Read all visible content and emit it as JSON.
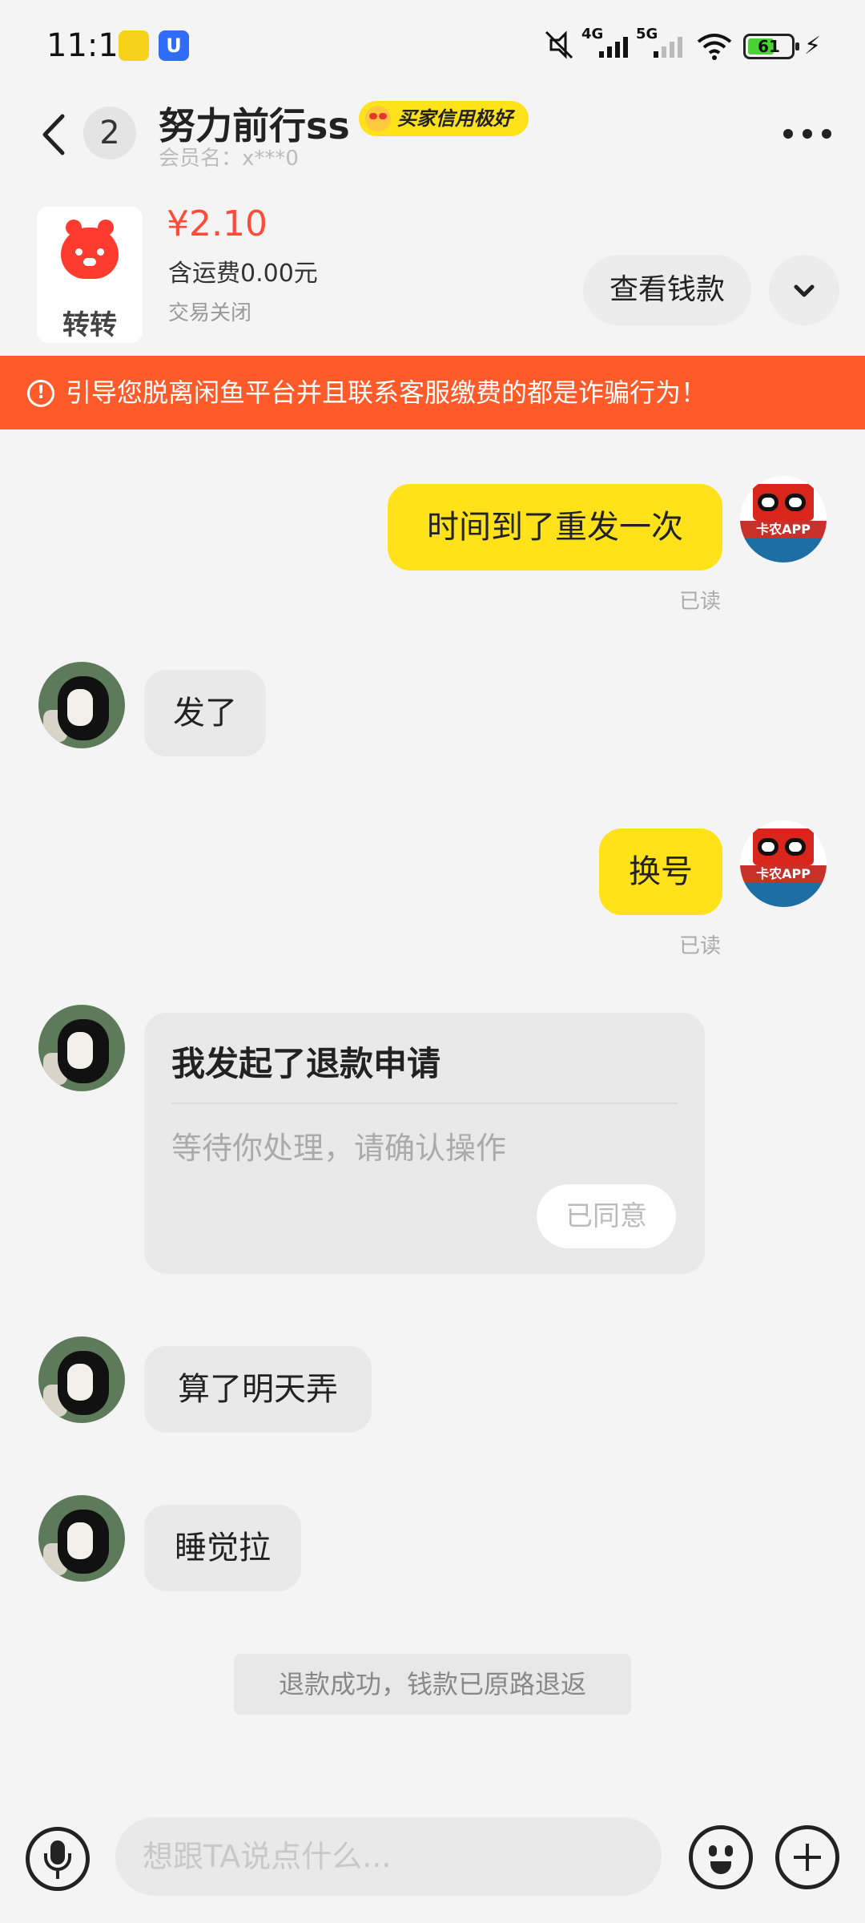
{
  "status_bar": {
    "time": "11:11",
    "app_icon_2": "U",
    "network_1": "4G",
    "network_2": "5G",
    "battery": "61",
    "battery_level": 0.61
  },
  "header": {
    "unread_count": "2",
    "nickname": "努力前行ss",
    "credit_badge": "买家信用极好",
    "member_name": "会员名：x***0"
  },
  "product": {
    "brand_text": "转转",
    "price": "¥2.10",
    "shipping": "含运费0.00元",
    "trade_state": "交易关闭",
    "view_money_label": "查看钱款"
  },
  "warning": {
    "text": "引导您脱离闲鱼平台并且联系客服缴费的都是诈骗行为！"
  },
  "messages": {
    "m1": "时间到了重发一次",
    "m1_read": "已读",
    "m2": "发了",
    "m3": "换号",
    "m3_read": "已读",
    "refund_title": "我发起了退款申请",
    "refund_desc": "等待你处理，请确认操作",
    "refund_status": "已同意",
    "m5": "算了明天弄",
    "m6": "睡觉拉",
    "system_notice": "退款成功，钱款已原路退返"
  },
  "self_avatar_text": "卡农APP",
  "input": {
    "placeholder": "想跟TA说点什么..."
  },
  "colors": {
    "accent_yellow": "#ffe21a",
    "warning_orange": "#ff5a2a",
    "price_red": "#ff4b3a",
    "background": "#f4f4f4"
  }
}
